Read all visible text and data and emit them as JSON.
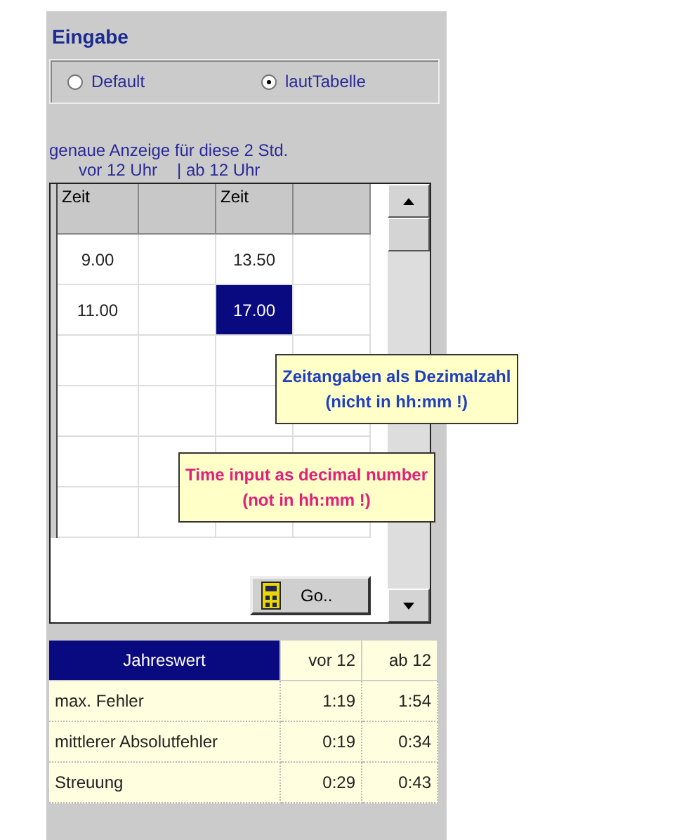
{
  "title": "Eingabe",
  "modes": [
    {
      "label": "Default",
      "selected": false
    },
    {
      "label": "lautTabelle",
      "selected": true
    }
  ],
  "hint": "genaue Anzeige für diese 2 Std.",
  "captions": [
    "vor 12 Uhr",
    "| ab 12 Uhr"
  ],
  "grid": {
    "headers": [
      "Zeit",
      "Zeit"
    ],
    "rows": [
      {
        "before": {
          "text": "9.00",
          "selected": false
        },
        "after": {
          "text": "13.50",
          "selected": false
        }
      },
      {
        "before": {
          "text": "11.00",
          "selected": false
        },
        "after": {
          "text": "17.00",
          "selected": true
        }
      }
    ]
  },
  "notes": [
    {
      "lines": [
        "Zeitangaben als Dezimalzahl",
        "(nicht in hh:mm !)"
      ],
      "color": "#2040c0"
    },
    {
      "lines": [
        "Time input as decimal number",
        "(not in hh:mm !)"
      ],
      "color": "#e0207a"
    }
  ],
  "go_button": "Go..",
  "stats": {
    "columns": [
      "Jahreswert",
      "vor 12",
      "ab 12"
    ],
    "rows": [
      {
        "label": "max. Fehler",
        "before": "1:19",
        "after": "1:54"
      },
      {
        "label": "mittlerer Absolutfehler",
        "before": "0:19",
        "after": "0:34"
      },
      {
        "label": "Streuung",
        "before": "0:29",
        "after": "0:43"
      }
    ]
  }
}
